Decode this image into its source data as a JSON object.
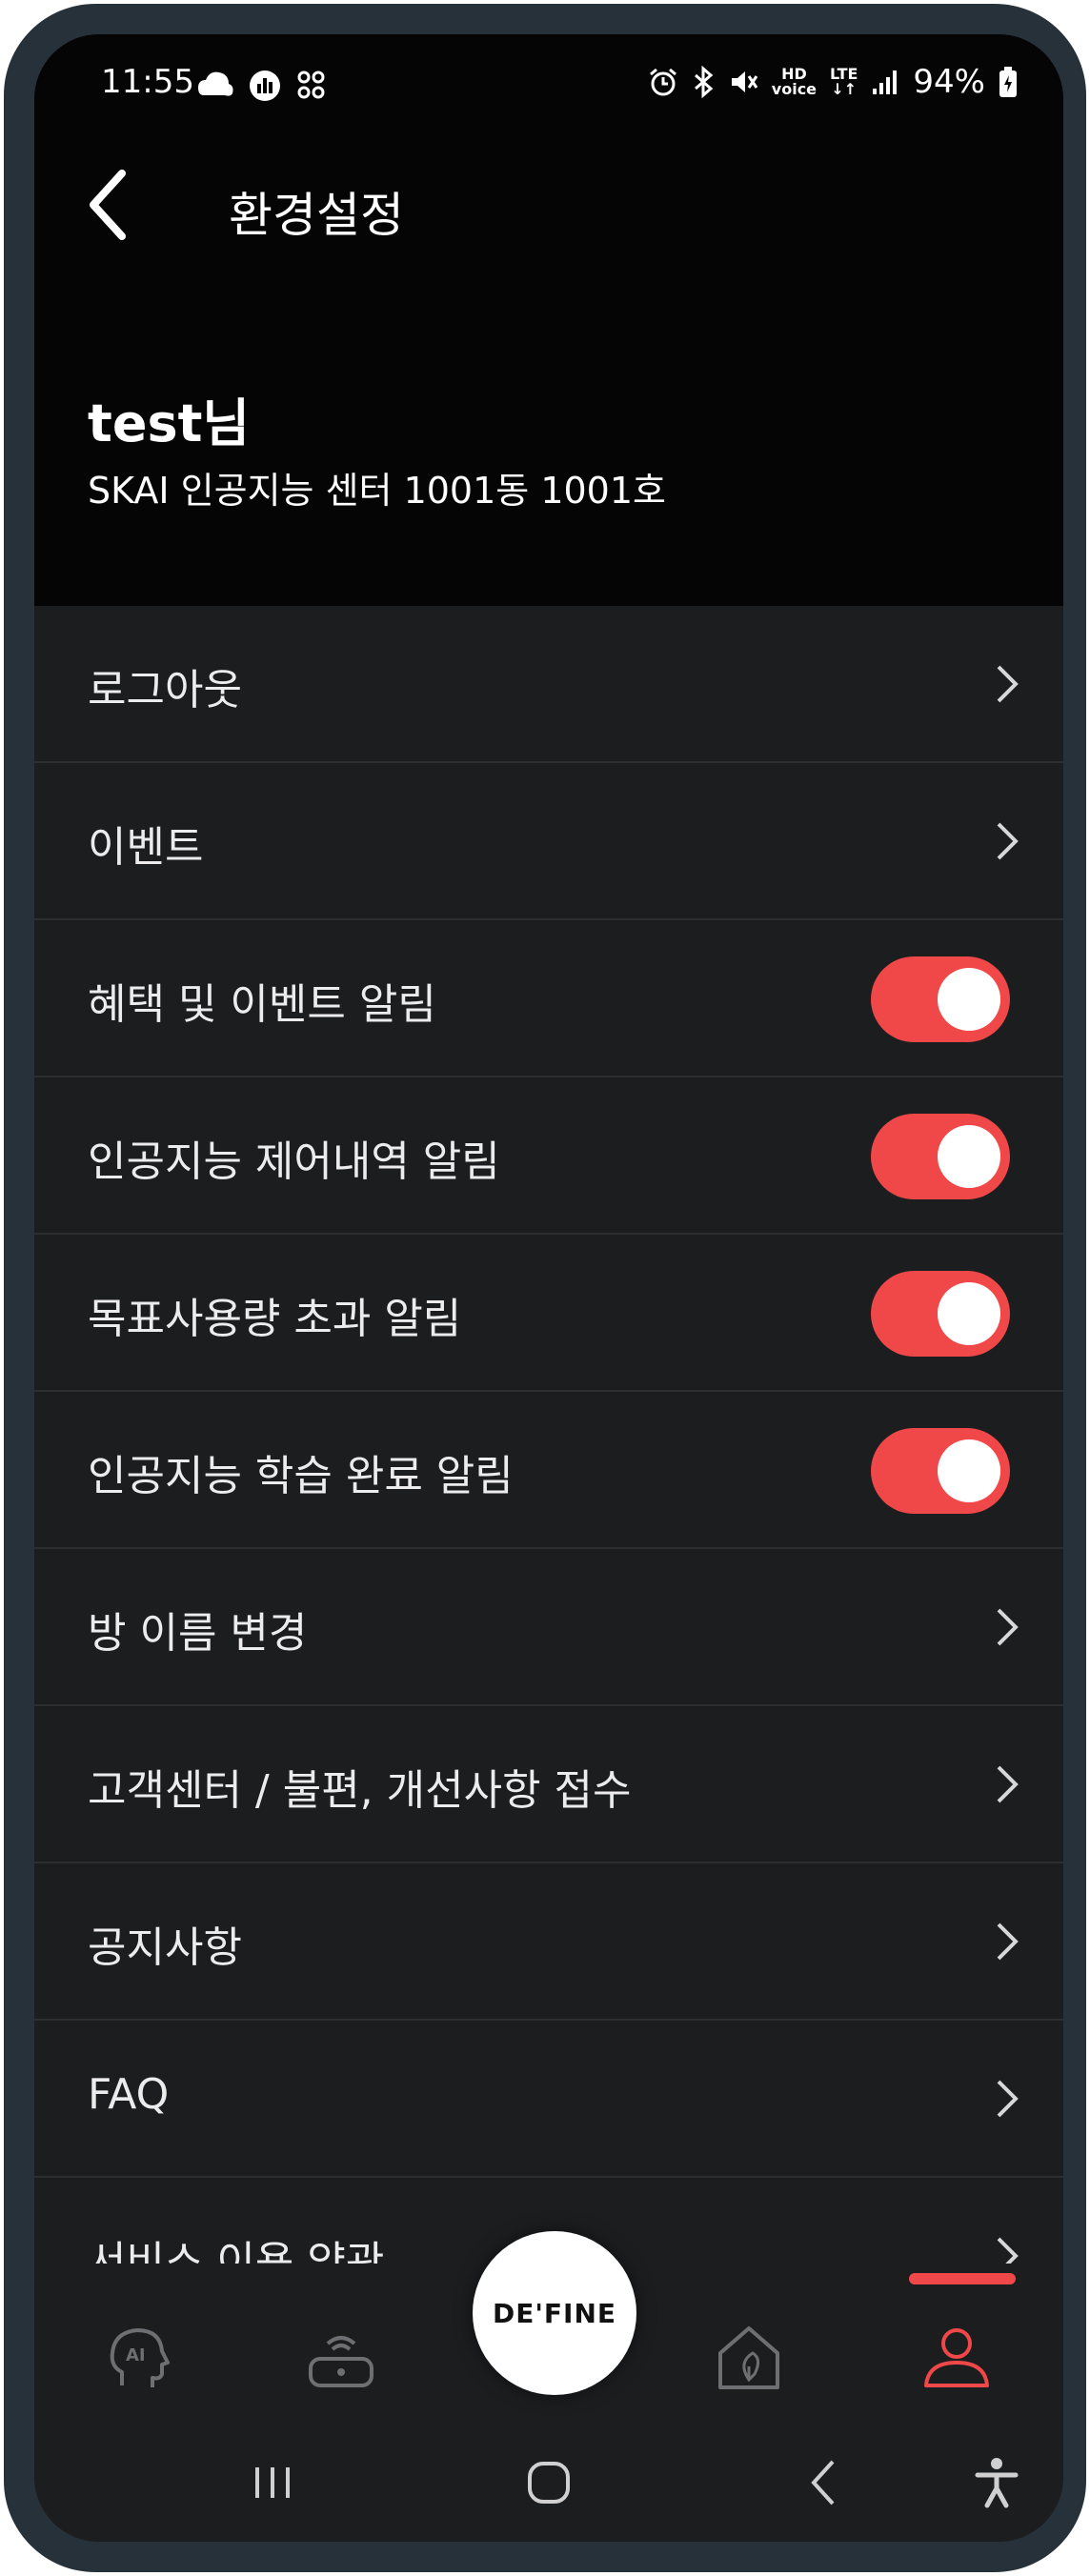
{
  "status_bar": {
    "time": "11:55",
    "battery": "94%",
    "left_icons": [
      "cloud-sync-icon",
      "chart-icon",
      "grid-icon"
    ],
    "right_icons": [
      "alarm-icon",
      "bluetooth-icon",
      "mute-icon",
      "hd-voice-icon",
      "lte-icon",
      "signal-icon",
      "battery-icon"
    ],
    "hd_text": "HD",
    "lte_text": "LTE"
  },
  "header": {
    "title": "환경설정"
  },
  "user": {
    "name": "test님",
    "address": "SKAI 인공지능 센터 1001동 1001호"
  },
  "menu": [
    {
      "label": "로그아웃",
      "type": "link"
    },
    {
      "label": "이벤트",
      "type": "link"
    },
    {
      "label": "혜택 및 이벤트 알림",
      "type": "toggle",
      "on": true
    },
    {
      "label": "인공지능 제어내역 알림",
      "type": "toggle",
      "on": true
    },
    {
      "label": "목표사용량 초과 알림",
      "type": "toggle",
      "on": true
    },
    {
      "label": "인공지능 학습 완료 알림",
      "type": "toggle",
      "on": true
    },
    {
      "label": "방 이름 변경",
      "type": "link"
    },
    {
      "label": "고객센터 / 불편, 개선사항 접수",
      "type": "link"
    },
    {
      "label": "공지사항",
      "type": "link"
    },
    {
      "label": "FAQ",
      "type": "link"
    },
    {
      "label": "서비스 이용 약관",
      "type": "link"
    }
  ],
  "bottom_nav": {
    "items": [
      "ai-head-icon",
      "wifi-router-icon",
      "home-leaf-icon",
      "user-icon"
    ],
    "center_logo": "DE'FINE",
    "active": "user-icon"
  },
  "colors": {
    "accent": "#f04848",
    "background": "#1c1d1f",
    "header": "#050505"
  }
}
